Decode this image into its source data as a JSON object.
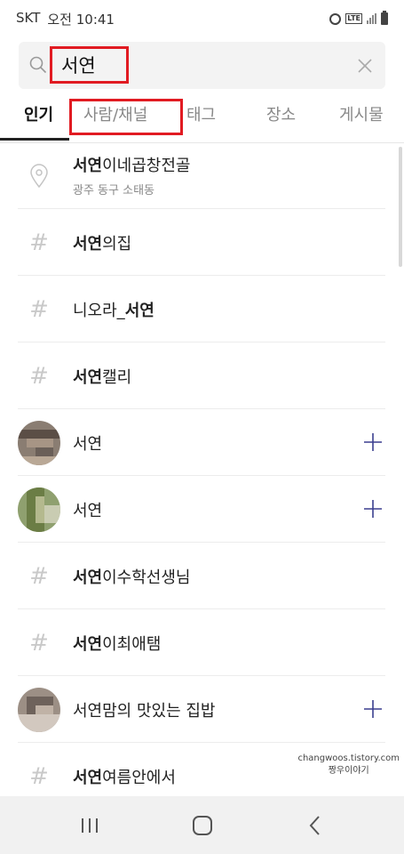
{
  "status_bar": {
    "carrier": "SKT",
    "time": "오전 10:41",
    "lte": "LTE"
  },
  "search": {
    "query": "서연",
    "placeholder": ""
  },
  "tabs": [
    {
      "label": "인기",
      "active": true
    },
    {
      "label": "사람/채널",
      "active": false
    },
    {
      "label": "태그",
      "active": false
    },
    {
      "label": "장소",
      "active": false
    },
    {
      "label": "게시물",
      "active": false
    }
  ],
  "results": [
    {
      "type": "place",
      "bold": "서연",
      "rest": "이네곱창전골",
      "sub": "광주 동구 소태동"
    },
    {
      "type": "tag",
      "bold": "서연",
      "rest": "의집"
    },
    {
      "type": "tag",
      "pre": "니오라_",
      "bold": "서연",
      "rest": ""
    },
    {
      "type": "tag",
      "bold": "서연",
      "rest": "캘리"
    },
    {
      "type": "person",
      "name": "서연"
    },
    {
      "type": "person",
      "name": "서연"
    },
    {
      "type": "tag",
      "bold": "서연",
      "rest": "이수학선생님"
    },
    {
      "type": "tag",
      "bold": "서연",
      "rest": "이최애탬"
    },
    {
      "type": "person",
      "name": "서연맘의 맛있는 집밥"
    },
    {
      "type": "tag",
      "bold": "서연",
      "rest": "여름안에서"
    }
  ],
  "watermark": {
    "line1": "changwoos.tistory.com",
    "line2": "짱우이야기"
  },
  "colors": {
    "highlight": "#e11b22",
    "plus": "#3b3f8f",
    "hash": "#c9c9c9"
  },
  "icons": {
    "search": "search-icon",
    "clear": "close-icon",
    "place": "map-pin-icon",
    "tag": "hashtag-icon",
    "follow": "plus-icon",
    "nav_recent": "recent-apps-icon",
    "nav_home": "home-icon",
    "nav_back": "back-icon"
  }
}
